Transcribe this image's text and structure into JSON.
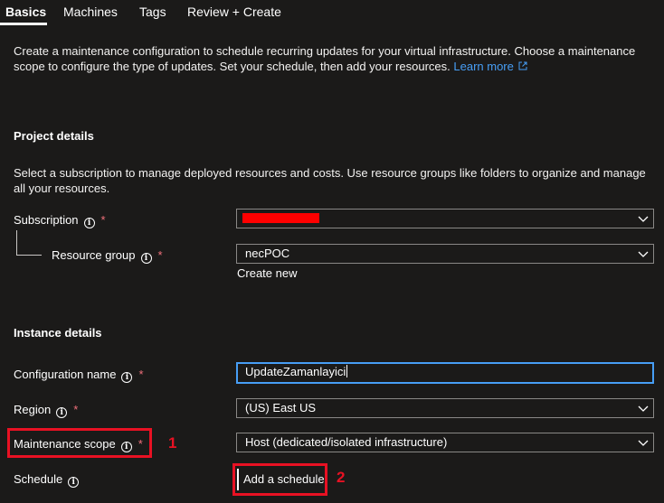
{
  "tabs": [
    {
      "label": "Basics",
      "active": true
    },
    {
      "label": "Machines",
      "active": false
    },
    {
      "label": "Tags",
      "active": false
    },
    {
      "label": "Review + Create",
      "active": false
    }
  ],
  "intro": {
    "text": "Create a maintenance configuration to schedule recurring updates for your virtual infrastructure. Choose a maintenance scope to configure the type of updates. Set your schedule, then add your resources.",
    "learn_more": "Learn more"
  },
  "project": {
    "title": "Project details",
    "description": "Select a subscription to manage deployed resources and costs. Use resource groups like folders to organize and manage all your resources.",
    "subscription_label": "Subscription",
    "subscription_value": "",
    "resource_group_label": "Resource group",
    "resource_group_value": "necPOC",
    "create_new": "Create new"
  },
  "instance": {
    "title": "Instance details",
    "config_name_label": "Configuration name",
    "config_name_value": "UpdateZamanlayici",
    "region_label": "Region",
    "region_value": "(US) East US",
    "scope_label": "Maintenance scope",
    "scope_value": "Host (dedicated/isolated infrastructure)",
    "schedule_label": "Schedule",
    "add_schedule": "Add a schedule"
  },
  "common": {
    "required_marker": "*",
    "info_glyph": "i"
  },
  "annotations": {
    "one": "1",
    "two": "2"
  },
  "colors": {
    "background": "#1b1a19",
    "link": "#479ef5",
    "annotation": "#e81123",
    "redaction": "#ff0000",
    "required": "#f1707b"
  },
  "icons": {
    "info": "info-icon",
    "chevron": "chevron-down-icon",
    "external": "external-link-icon"
  }
}
